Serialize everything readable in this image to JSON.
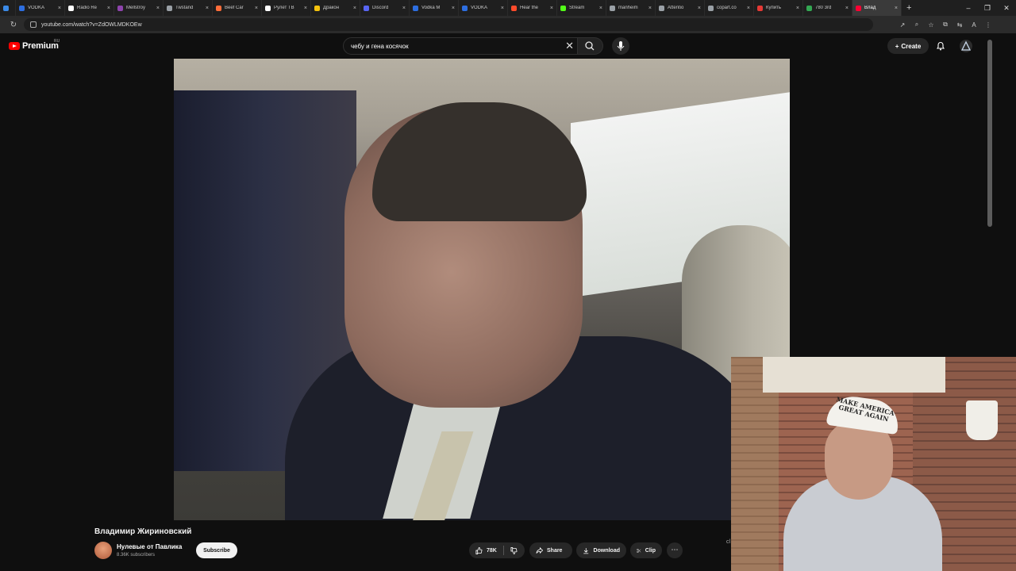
{
  "browser": {
    "tabs": [
      {
        "label": "",
        "color": "#3b8ae6"
      },
      {
        "label": "VODKA",
        "color": "#2d6ee0"
      },
      {
        "label": "Radio Re",
        "color": "#ffffff"
      },
      {
        "label": "Mellstroy",
        "color": "#8e44ad"
      },
      {
        "label": "Twstand",
        "color": "#9aa0a6"
      },
      {
        "label": "Beef Car",
        "color": "#ff6d3a"
      },
      {
        "label": "Рулет ТВ",
        "color": "#ffffff"
      },
      {
        "label": "Дракон",
        "color": "#f4c20d"
      },
      {
        "label": "Discord",
        "color": "#5865f2"
      },
      {
        "label": "Vodka M",
        "color": "#2d6ee0"
      },
      {
        "label": "VODKA",
        "color": "#2d6ee0"
      },
      {
        "label": "Hear the",
        "color": "#ff4b2b"
      },
      {
        "label": "Stream",
        "color": "#53fc18"
      },
      {
        "label": "manheim",
        "color": "#9aa0a6"
      },
      {
        "label": "Attentio",
        "color": "#9aa0a6"
      },
      {
        "label": "copart.co",
        "color": "#9aa0a6"
      },
      {
        "label": "Купить",
        "color": "#e53935"
      },
      {
        "label": "780 3rd",
        "color": "#34a853"
      },
      {
        "label": "Влад",
        "color": "#ff0033"
      }
    ],
    "url": "youtube.com/watch?v=ZdOWLMDKOEw",
    "new_tab": "+",
    "tab_close": "×",
    "window_controls": [
      "–",
      "❐",
      "✕"
    ]
  },
  "header": {
    "brand": "Premium",
    "region": "RU",
    "search_query": "чебу и гена косячок",
    "clear_symbol": "✕",
    "create_label": "Create",
    "create_symbol": "+"
  },
  "video": {
    "title": "Владимир Жириновский"
  },
  "webcam": {
    "hat_text": "MAKE AMERICA GREAT AGAIN"
  },
  "channel": {
    "name": "Нулевые от Павлика",
    "subscribers": "8.36K subscribers",
    "subscribe_label": "Subscribe"
  },
  "actions": {
    "likes": "78K",
    "share": "Share",
    "download": "Download",
    "clip": "Clip",
    "more": "⋯",
    "stray": "cl"
  },
  "colors": {
    "accent": "#ff0000",
    "background": "#0f0f0f",
    "pill": "#272727"
  }
}
